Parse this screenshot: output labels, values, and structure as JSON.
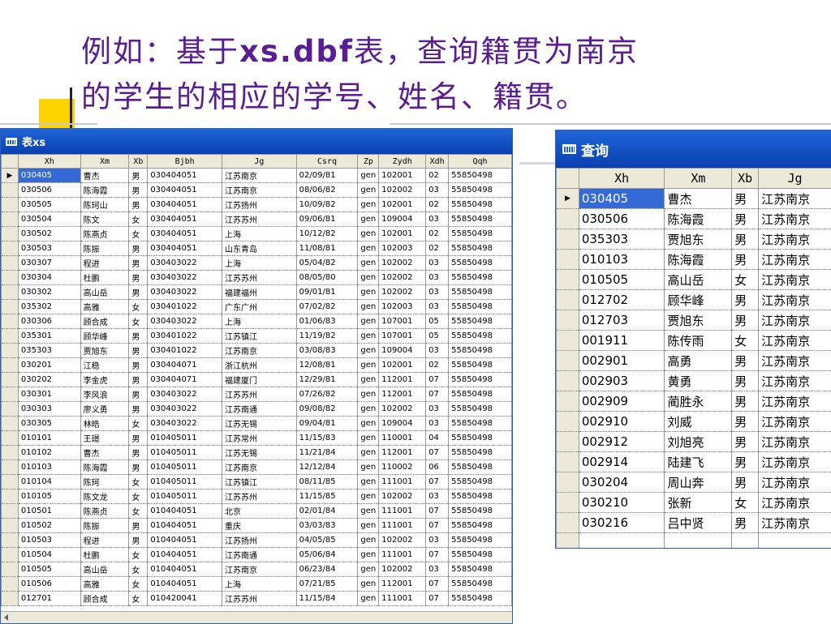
{
  "slide": {
    "title_line1_pre": "例如：基于",
    "title_line1_bold": "xs.dbf",
    "title_line1_post": "表，查询籍贯为南京",
    "title_line2": "的学生的相应的学号、姓名、籍贯。"
  },
  "colors": {
    "title_text": "#5a1d96",
    "accent_yellow": "#ffd200",
    "titlebar_blue": "#1f66d9",
    "selection_blue": "#3569d5"
  },
  "left_window": {
    "title": "表xs",
    "columns": [
      "Xh",
      "Xm",
      "Xb",
      "Bjbh",
      "Jg",
      "Csrq",
      "Zp",
      "Zydh",
      "Xdh",
      "Qqh"
    ],
    "rows": [
      [
        "030405",
        "曹杰",
        "男",
        "030404051",
        "江苏南京",
        "02/09/81",
        "gen",
        "102001",
        "02",
        "55850498"
      ],
      [
        "030506",
        "陈海霞",
        "男",
        "030404051",
        "江苏南京",
        "08/06/82",
        "gen",
        "102002",
        "03",
        "55850498"
      ],
      [
        "030505",
        "陈珂山",
        "男",
        "030404051",
        "江苏扬州",
        "10/09/82",
        "gen",
        "102001",
        "02",
        "55850498"
      ],
      [
        "030504",
        "陈文",
        "女",
        "030404051",
        "江苏苏州",
        "09/06/81",
        "gen",
        "109004",
        "03",
        "55850498"
      ],
      [
        "030502",
        "陈燕贞",
        "女",
        "030404051",
        "上海",
        "10/12/82",
        "gen",
        "102001",
        "02",
        "55850498"
      ],
      [
        "030503",
        "陈振",
        "男",
        "030404051",
        "山东青岛",
        "11/08/81",
        "gen",
        "102003",
        "02",
        "55850498"
      ],
      [
        "030307",
        "程进",
        "男",
        "030403022",
        "上海",
        "05/04/82",
        "gen",
        "102002",
        "03",
        "55850498"
      ],
      [
        "030304",
        "杜鹏",
        "男",
        "030403022",
        "江苏苏州",
        "08/05/80",
        "gen",
        "102002",
        "03",
        "55850498"
      ],
      [
        "030302",
        "高山岳",
        "男",
        "030403022",
        "福建福州",
        "09/01/81",
        "gen",
        "102002",
        "03",
        "55850498"
      ],
      [
        "035302",
        "高雅",
        "女",
        "030401022",
        "广东广州",
        "07/02/82",
        "gen",
        "102003",
        "03",
        "55850498"
      ],
      [
        "030306",
        "顾合成",
        "女",
        "030403022",
        "上海",
        "01/06/83",
        "gen",
        "107001",
        "05",
        "55850498"
      ],
      [
        "035301",
        "顾华峰",
        "男",
        "030401022",
        "江苏镇江",
        "11/19/82",
        "gen",
        "107001",
        "05",
        "55850498"
      ],
      [
        "035303",
        "贾旭东",
        "男",
        "030401022",
        "江苏南京",
        "03/08/83",
        "gen",
        "109004",
        "03",
        "55850498"
      ],
      [
        "030201",
        "江稳",
        "男",
        "030404071",
        "浙江杭州",
        "12/08/81",
        "gen",
        "102001",
        "02",
        "55850498"
      ],
      [
        "030202",
        "李金虎",
        "男",
        "030404071",
        "福建厦门",
        "12/29/81",
        "gen",
        "112001",
        "07",
        "55850498"
      ],
      [
        "030301",
        "李风浪",
        "男",
        "030403022",
        "江苏苏州",
        "07/26/82",
        "gen",
        "112001",
        "07",
        "55850498"
      ],
      [
        "030303",
        "廖义勇",
        "男",
        "030403022",
        "江苏南通",
        "09/08/82",
        "gen",
        "102002",
        "03",
        "55850498"
      ],
      [
        "030305",
        "林皓",
        "女",
        "030403022",
        "江苏无锡",
        "09/04/81",
        "gen",
        "109004",
        "03",
        "55850498"
      ],
      [
        "010101",
        "王璟",
        "男",
        "010405011",
        "江苏常州",
        "11/15/83",
        "gen",
        "110001",
        "04",
        "55850498"
      ],
      [
        "010102",
        "曹杰",
        "男",
        "010405011",
        "江苏无锡",
        "11/21/84",
        "gen",
        "112001",
        "07",
        "55850498"
      ],
      [
        "010103",
        "陈海霞",
        "男",
        "010405011",
        "江苏南京",
        "12/12/84",
        "gen",
        "110002",
        "06",
        "55850498"
      ],
      [
        "010104",
        "陈珂",
        "女",
        "010405011",
        "江苏镇江",
        "08/11/85",
        "gen",
        "111001",
        "07",
        "55850498"
      ],
      [
        "010105",
        "陈文龙",
        "女",
        "010405011",
        "江苏苏州",
        "11/15/85",
        "gen",
        "102002",
        "03",
        "55850498"
      ],
      [
        "010501",
        "陈燕贞",
        "女",
        "010404051",
        "北京",
        "02/01/84",
        "gen",
        "111001",
        "07",
        "55850498"
      ],
      [
        "010502",
        "陈振",
        "男",
        "010404051",
        "重庆",
        "03/03/83",
        "gen",
        "111001",
        "07",
        "55850498"
      ],
      [
        "010503",
        "程进",
        "男",
        "010404051",
        "江苏扬州",
        "04/05/85",
        "gen",
        "102002",
        "03",
        "55850498"
      ],
      [
        "010504",
        "杜鹏",
        "女",
        "010404051",
        "江苏南通",
        "05/06/84",
        "gen",
        "111001",
        "07",
        "55850498"
      ],
      [
        "010505",
        "高山岳",
        "女",
        "010404051",
        "江苏南京",
        "06/23/84",
        "gen",
        "102002",
        "03",
        "55850498"
      ],
      [
        "010506",
        "高雅",
        "女",
        "010404051",
        "上海",
        "07/21/85",
        "gen",
        "112001",
        "07",
        "55850498"
      ],
      [
        "012701",
        "顾合成",
        "女",
        "010420041",
        "江苏苏州",
        "11/15/84",
        "gen",
        "111001",
        "07",
        "55850498"
      ]
    ]
  },
  "right_window": {
    "title": "查询",
    "columns": [
      "Xh",
      "Xm",
      "Xb",
      "Jg"
    ],
    "rows": [
      [
        "030405",
        "曹杰",
        "男",
        "江苏南京"
      ],
      [
        "030506",
        "陈海霞",
        "男",
        "江苏南京"
      ],
      [
        "035303",
        "贾旭东",
        "男",
        "江苏南京"
      ],
      [
        "010103",
        "陈海霞",
        "男",
        "江苏南京"
      ],
      [
        "010505",
        "高山岳",
        "女",
        "江苏南京"
      ],
      [
        "012702",
        "顾华峰",
        "男",
        "江苏南京"
      ],
      [
        "012703",
        "贾旭东",
        "男",
        "江苏南京"
      ],
      [
        "001911",
        "陈传雨",
        "女",
        "江苏南京"
      ],
      [
        "002901",
        "高勇",
        "男",
        "江苏南京"
      ],
      [
        "002903",
        "黄勇",
        "男",
        "江苏南京"
      ],
      [
        "002909",
        "蔺胜永",
        "男",
        "江苏南京"
      ],
      [
        "002910",
        "刘威",
        "男",
        "江苏南京"
      ],
      [
        "002912",
        "刘旭亮",
        "男",
        "江苏南京"
      ],
      [
        "002914",
        "陆建飞",
        "男",
        "江苏南京"
      ],
      [
        "030204",
        "周山奔",
        "男",
        "江苏南京"
      ],
      [
        "030210",
        "张新",
        "女",
        "江苏南京"
      ],
      [
        "030216",
        "吕中贤",
        "男",
        "江苏南京"
      ]
    ]
  }
}
